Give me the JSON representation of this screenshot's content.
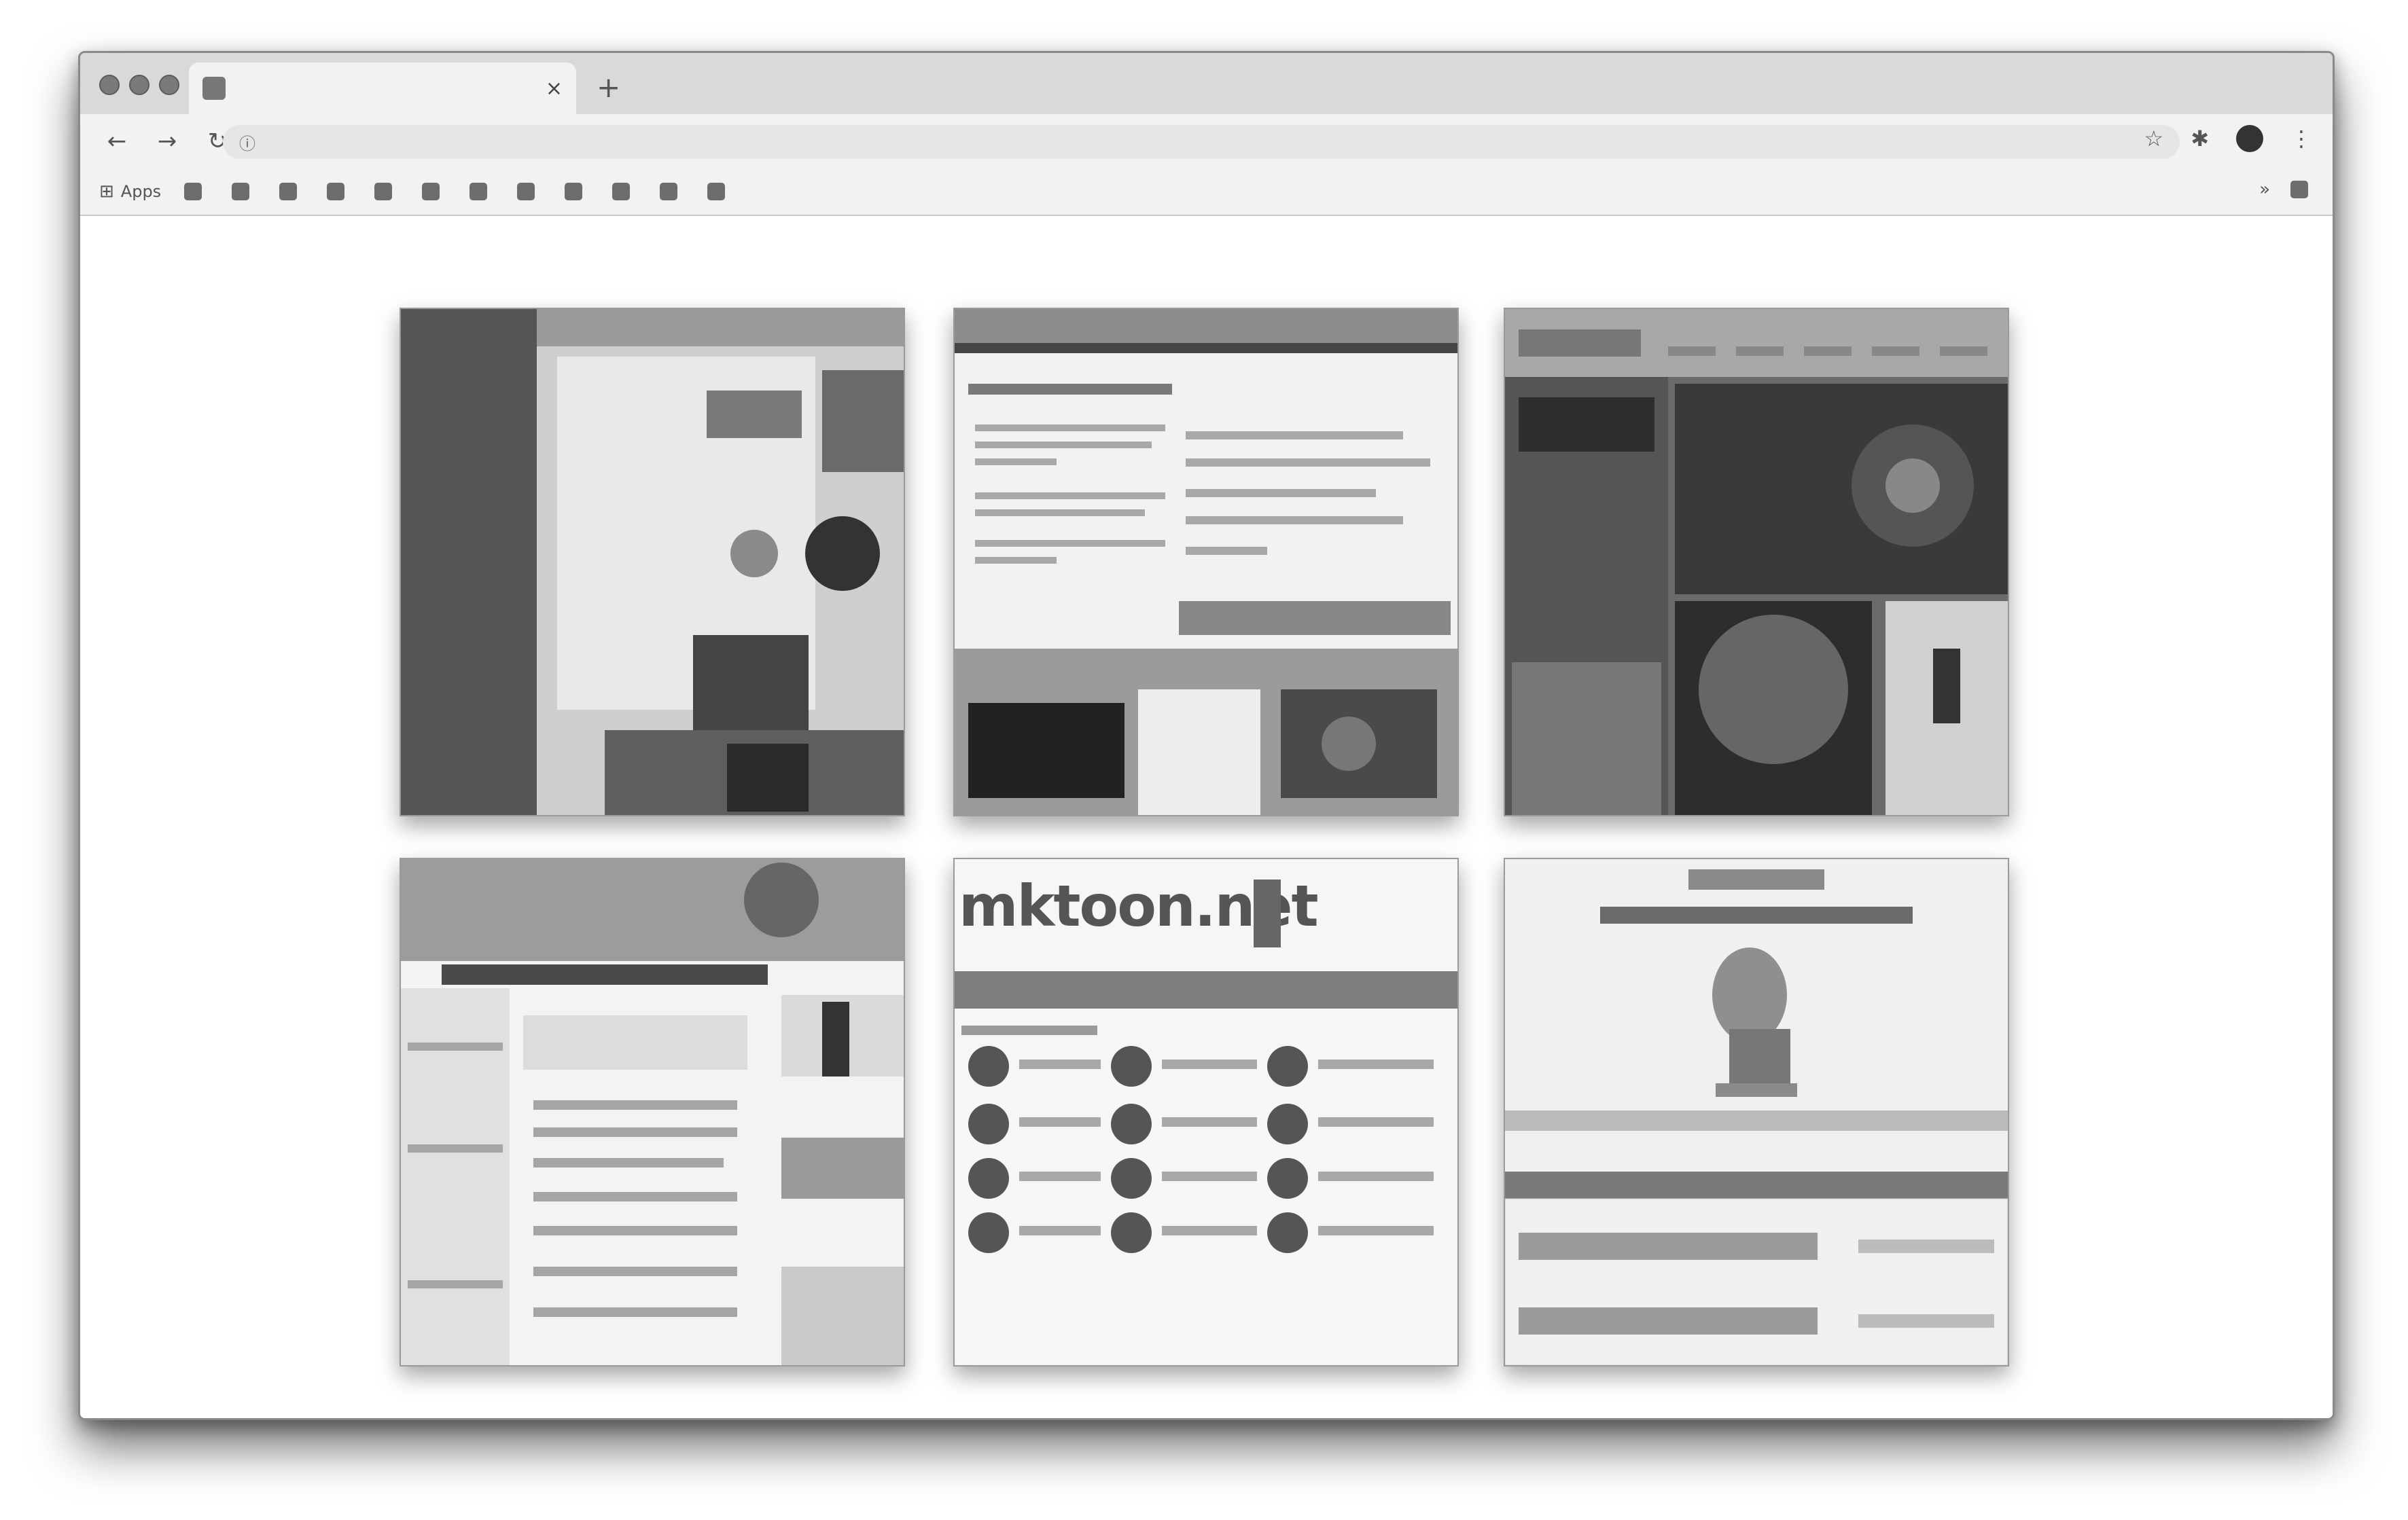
{
  "browser": {
    "tab": {
      "title": "",
      "close_icon": "close-icon"
    },
    "new_tab_icon": "plus-icon",
    "omnibox": {
      "url": ""
    },
    "bookmarks": [
      {
        "label": "Apps"
      },
      {
        "label": ""
      },
      {
        "label": ""
      },
      {
        "label": ""
      },
      {
        "label": ""
      },
      {
        "label": ""
      },
      {
        "label": ""
      },
      {
        "label": ""
      },
      {
        "label": ""
      },
      {
        "label": ""
      },
      {
        "label": ""
      },
      {
        "label": ""
      },
      {
        "label": ""
      }
    ],
    "other_bookmarks": ""
  },
  "tiles": [
    {
      "name": "tile-1",
      "caption": ""
    },
    {
      "name": "tile-2",
      "caption": ""
    },
    {
      "name": "tile-3",
      "caption": ""
    },
    {
      "name": "tile-4",
      "caption": ""
    },
    {
      "name": "tile-5",
      "caption": "",
      "logo_text": "mktoon.net"
    },
    {
      "name": "tile-6",
      "caption": ""
    }
  ],
  "colors": {
    "frame": "#d9d9d9",
    "toolbar": "#f2f2f2",
    "content": "#ffffff"
  }
}
